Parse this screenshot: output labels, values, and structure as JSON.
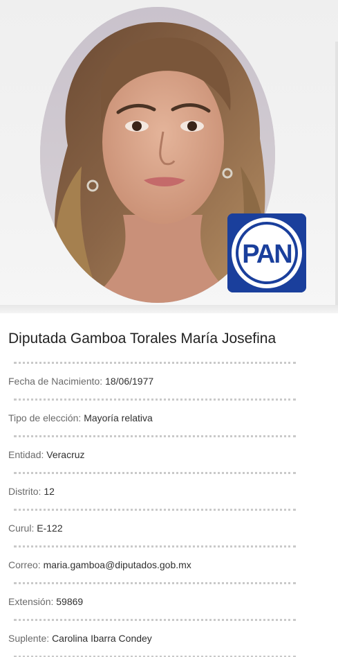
{
  "profile": {
    "name": "Diputada Gamboa Torales María Josefina",
    "party": "PAN",
    "brand_color": "#1a3f9c"
  },
  "fields": [
    {
      "label": "Fecha de Nacimiento:",
      "value": "18/06/1977"
    },
    {
      "label": "Tipo de elección:",
      "value": "Mayoría relativa"
    },
    {
      "label": "Entidad:",
      "value": "Veracruz"
    },
    {
      "label": "Distrito:",
      "value": "12"
    },
    {
      "label": "Curul:",
      "value": "E-122"
    },
    {
      "label": "Correo:",
      "value": "maria.gamboa@diputados.gob.mx"
    },
    {
      "label": "Extensión:",
      "value": "59869"
    },
    {
      "label": "Suplente:",
      "value": "Carolina Ibarra Condey"
    }
  ]
}
